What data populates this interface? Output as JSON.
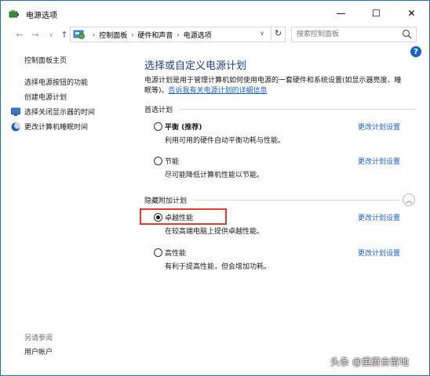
{
  "window": {
    "title": "电源选项",
    "minimize_glyph": "—",
    "maximize_glyph": "☐",
    "close_glyph": "✕"
  },
  "nav": {
    "back_glyph": "←",
    "forward_glyph": "→",
    "recent_glyph": "∨",
    "up_glyph": "↑",
    "refresh_glyph": "↻",
    "dropdown_glyph": "∨"
  },
  "breadcrumb": {
    "items": [
      "控制面板",
      "硬件和声音",
      "电源选项"
    ],
    "separator": "›"
  },
  "search": {
    "placeholder": "搜索控制面板"
  },
  "sidebar": {
    "home": "控制面板主页",
    "links": [
      "选择电源按钮的功能",
      "创建电源计划"
    ],
    "icon_links": [
      {
        "label": "选择关闭显示器的时间",
        "icon": "monitor-icon"
      },
      {
        "label": "更改计算机睡眠时间",
        "icon": "moon-icon"
      }
    ],
    "see_also": "另请参阅",
    "user_accounts": "用户帐户"
  },
  "help": {
    "glyph": "?"
  },
  "main": {
    "title": "选择或自定义电源计划",
    "desc_line1": "电源计划是用于管理计算机如何使用电源的一套硬件和系统设置(如显示器亮度、睡",
    "desc_line2_prefix": "眠等)。",
    "desc_link": "告诉我有关电源计划的详细信息",
    "preferred_header": "首选计划",
    "hidden_header": "隐藏附加计划",
    "collapse_glyph": "︿",
    "change_label": "更改计划设置",
    "preferred_plans": [
      {
        "name": "平衡 (推荐)",
        "desc": "利用可用的硬件自动平衡功耗与性能。",
        "checked": false
      },
      {
        "name": "节能",
        "desc": "尽可能降低计算机性能以节能。",
        "checked": false
      }
    ],
    "hidden_plans": [
      {
        "name": "卓越性能",
        "desc": "在较高端电脑上提供卓越性能。",
        "checked": true
      },
      {
        "name": "高性能",
        "desc": "有利于提高性能，但会增加功耗。",
        "checked": false
      }
    ]
  },
  "watermark": "头条 @重蔚自留地",
  "colors": {
    "accent_link": "#1a5fd8",
    "title_blue": "#1e3f8a",
    "highlight_red": "#e53935",
    "desktop_blue": "#1e5ba8"
  }
}
